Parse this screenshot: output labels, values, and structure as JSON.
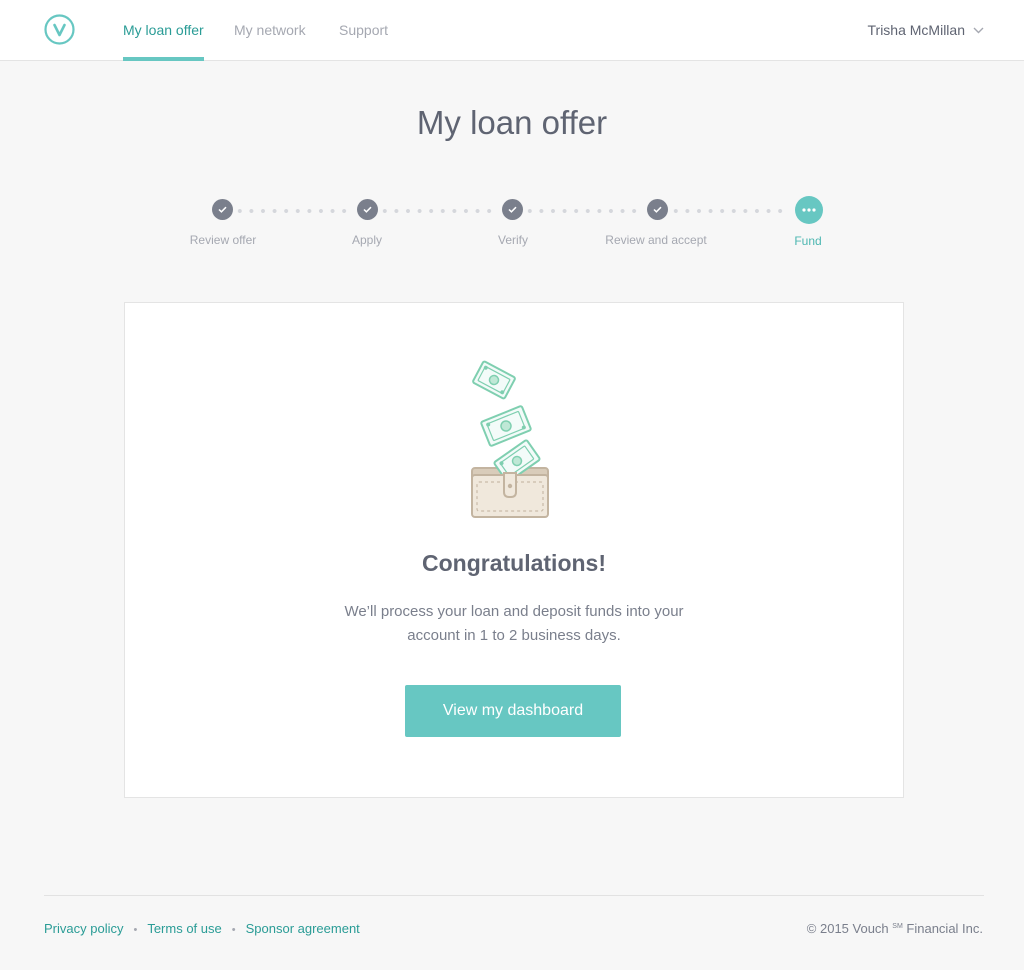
{
  "header": {
    "logo_letter": "v",
    "tabs": [
      {
        "label": "My loan offer",
        "active": true
      },
      {
        "label": "My network",
        "active": false
      },
      {
        "label": "Support",
        "active": false
      }
    ],
    "user_name": "Trisha McMillan",
    "user_menu_icon": "chevron-down-icon"
  },
  "page": {
    "title": "My loan offer"
  },
  "stepper": {
    "steps": [
      {
        "label": "Review offer",
        "status": "complete",
        "icon": "check-icon"
      },
      {
        "label": "Apply",
        "status": "complete",
        "icon": "check-icon"
      },
      {
        "label": "Verify",
        "status": "complete",
        "icon": "check-icon"
      },
      {
        "label": "Review and accept",
        "status": "complete",
        "icon": "check-icon"
      },
      {
        "label": "Fund",
        "status": "current",
        "icon": "ellipsis-icon"
      }
    ]
  },
  "card": {
    "illustration": "money-into-wallet-icon",
    "heading": "Congratulations!",
    "message_line1": "We’ll process your loan and deposit funds into your",
    "message_line2": "account in 1 to 2 business days.",
    "button_label": "View my dashboard"
  },
  "footer": {
    "links": [
      "Privacy policy",
      "Terms of use",
      "Sponsor agreement"
    ],
    "separator": "•",
    "copyright_prefix": "© 2015 Vouch",
    "copyright_mark": "SM",
    "copyright_suffix": " Financial Inc."
  },
  "colors": {
    "accent": "#67c7c2",
    "accent_text": "#2a9c96",
    "step_complete": "#7a7f8c",
    "text_primary": "#5f6472",
    "text_muted": "#a5a8b1",
    "page_background": "#f7f7f7"
  }
}
